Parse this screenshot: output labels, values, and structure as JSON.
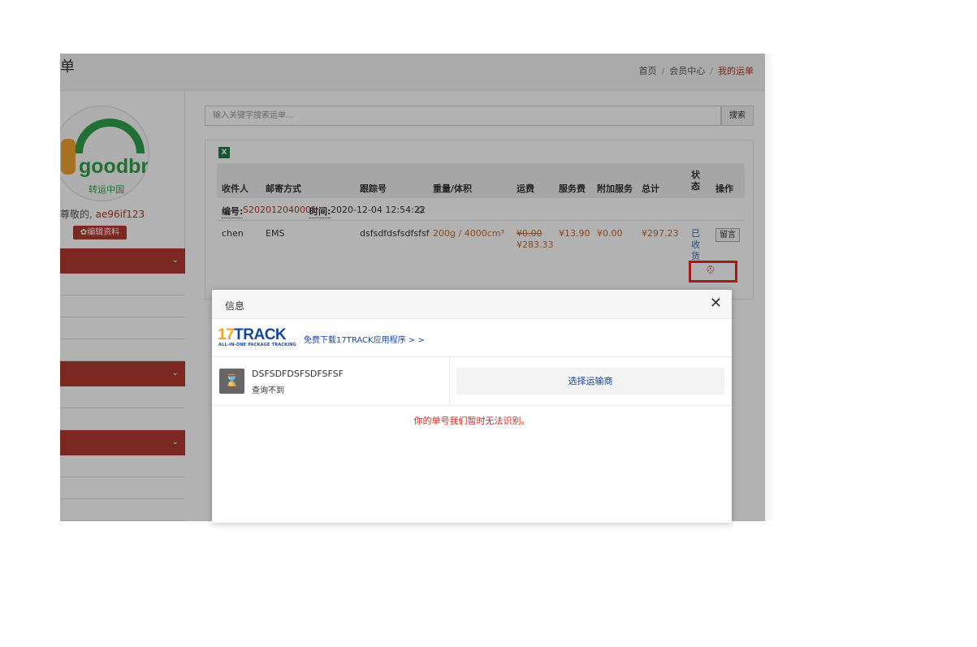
{
  "page": {
    "title_fragment": "单",
    "breadcrumb": [
      "首页",
      "会员中心",
      "我的运单"
    ]
  },
  "sidebar": {
    "greeting": "尊敬的,",
    "username": "ae96if123",
    "edit_label": "编辑资料",
    "logo_text": "goodbring",
    "logo_sub": "转运中国"
  },
  "search": {
    "placeholder": "输入关键字搜索运单...",
    "button_label": "搜索"
  },
  "table": {
    "headers": [
      "收件人",
      "邮寄方式",
      "跟踪号",
      "重量/体积",
      "运费",
      "服务费",
      "附加服务",
      "总计",
      "状态",
      "操作"
    ],
    "order_label": "编号:",
    "order_no": "S202012040001",
    "time_label": "时间:",
    "time_value": "2020-12-04 12:54:22",
    "row": {
      "recipient": "chen",
      "method": "EMS",
      "tracking": "dsfsdfdsfsdfsfsf",
      "weight": "200g",
      "slash": "/",
      "volume": "4000cm³",
      "freight_old": "¥0.00",
      "freight": "¥283.33",
      "service_fee": "¥13.90",
      "extra": "¥0.00",
      "total": "¥297.23",
      "status": "已收货",
      "action": "留言"
    }
  },
  "modal": {
    "title": "信息",
    "brand_main": "TRACK",
    "brand_num": "17",
    "brand_sub": "ALL-IN-ONE PACKAGE TRACKING",
    "app_link": "免费下载17TRACK应用程序 > >",
    "tracking_no": "DSFSDFDSFSDFSFSF",
    "tracking_status": "查询不到",
    "carrier_btn": "选择运输商",
    "error": "你的单号我们暂时无法识别。"
  },
  "colors": {
    "accent": "#b03a2e",
    "link": "#17469e",
    "error": "#d2281d",
    "highlight_box": "#e8271d"
  }
}
